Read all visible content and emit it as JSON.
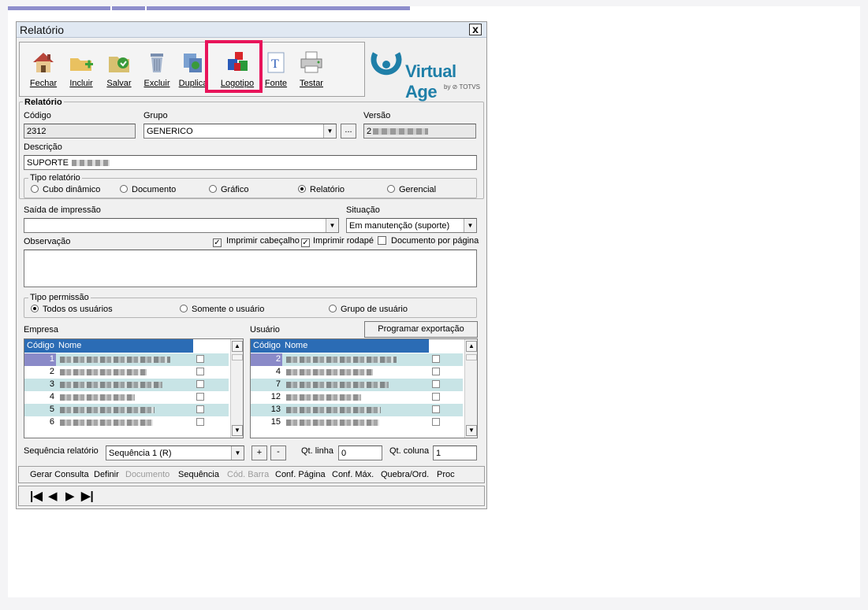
{
  "window": {
    "title": "Relatório",
    "close_label": "x"
  },
  "toolbar": {
    "buttons": [
      {
        "label": "Fechar",
        "icon": "house-icon"
      },
      {
        "label": "Incluir",
        "icon": "folder-add-icon"
      },
      {
        "label": "Salvar",
        "icon": "save-icon"
      },
      {
        "label": "Excluir",
        "icon": "trash-icon"
      },
      {
        "label": "Duplica",
        "icon": "duplicate-icon"
      },
      {
        "label": "Logotipo",
        "icon": "logo-shapes-icon"
      },
      {
        "label": "Fonte",
        "icon": "font-icon"
      },
      {
        "label": "Testar",
        "icon": "printer-icon"
      }
    ]
  },
  "brand": {
    "name": "Virtual Age",
    "by": "by ⊘ TOTVS",
    "color": "#1f7fa8"
  },
  "highlight_color": "#e8145a",
  "form": {
    "group_title": "Relatório",
    "codigo_label": "Código",
    "codigo_value": "2312",
    "grupo_label": "Grupo",
    "grupo_value": "GENERICO",
    "grupo_more": "...",
    "versao_label": "Versão",
    "versao_value": "2",
    "descricao_label": "Descrição",
    "descricao_value": "SUPORTE",
    "tipo_relatorio": {
      "label": "Tipo relatório",
      "options": [
        "Cubo dinâmico",
        "Documento",
        "Gráfico",
        "Relatório",
        "Gerencial"
      ],
      "selected": "Relatório"
    },
    "saida_label": "Saída de impressão",
    "saida_value": "",
    "situacao_label": "Situação",
    "situacao_value": "Em manutenção (suporte)",
    "observacao_label": "Observação",
    "observacao_value": "",
    "imprimir_cabecalho": {
      "label": "Imprimir cabeçalho",
      "checked": true
    },
    "imprimir_rodape": {
      "label": "Imprimir rodapé",
      "checked": true
    },
    "documento_por_pagina": {
      "label": "Documento por página",
      "checked": false
    },
    "tipo_permissao": {
      "label": "Tipo permissão",
      "options": [
        "Todos os usuários",
        "Somente o usuário",
        "Grupo de usuário"
      ],
      "selected": "Todos os usuários"
    },
    "empresa_label": "Empresa",
    "usuario_label": "Usuário",
    "programar_label": "Programar exportação",
    "col_codigo": "Código",
    "col_nome": "Nome",
    "col_dot": ".",
    "empresa_rows": [
      {
        "codigo": "1",
        "selected": true
      },
      {
        "codigo": "2"
      },
      {
        "codigo": "3"
      },
      {
        "codigo": "4"
      },
      {
        "codigo": "5"
      },
      {
        "codigo": "6"
      }
    ],
    "usuario_rows": [
      {
        "codigo": "2",
        "selected": true
      },
      {
        "codigo": "4"
      },
      {
        "codigo": "7"
      },
      {
        "codigo": "12"
      },
      {
        "codigo": "13"
      },
      {
        "codigo": "15"
      }
    ],
    "sequencia_label": "Sequência relatório",
    "sequencia_value": "Sequência 1 (R)",
    "plus": "+",
    "minus": "-",
    "qt_linha_label": "Qt. linha",
    "qt_linha_value": "0",
    "qt_coluna_label": "Qt. coluna",
    "qt_coluna_value": "1"
  },
  "menu": {
    "items": [
      "Gerar Consulta",
      "Definir",
      "Documento",
      "Sequência",
      "Cód. Barra",
      "Conf. Página",
      "Conf. Máx.",
      "Quebra/Ord.",
      "Proc"
    ],
    "disabled": [
      "Documento",
      "Cód. Barra"
    ]
  },
  "nav": {
    "first": "|◀",
    "prev": "◀",
    "next": "▶",
    "last": "▶|"
  }
}
